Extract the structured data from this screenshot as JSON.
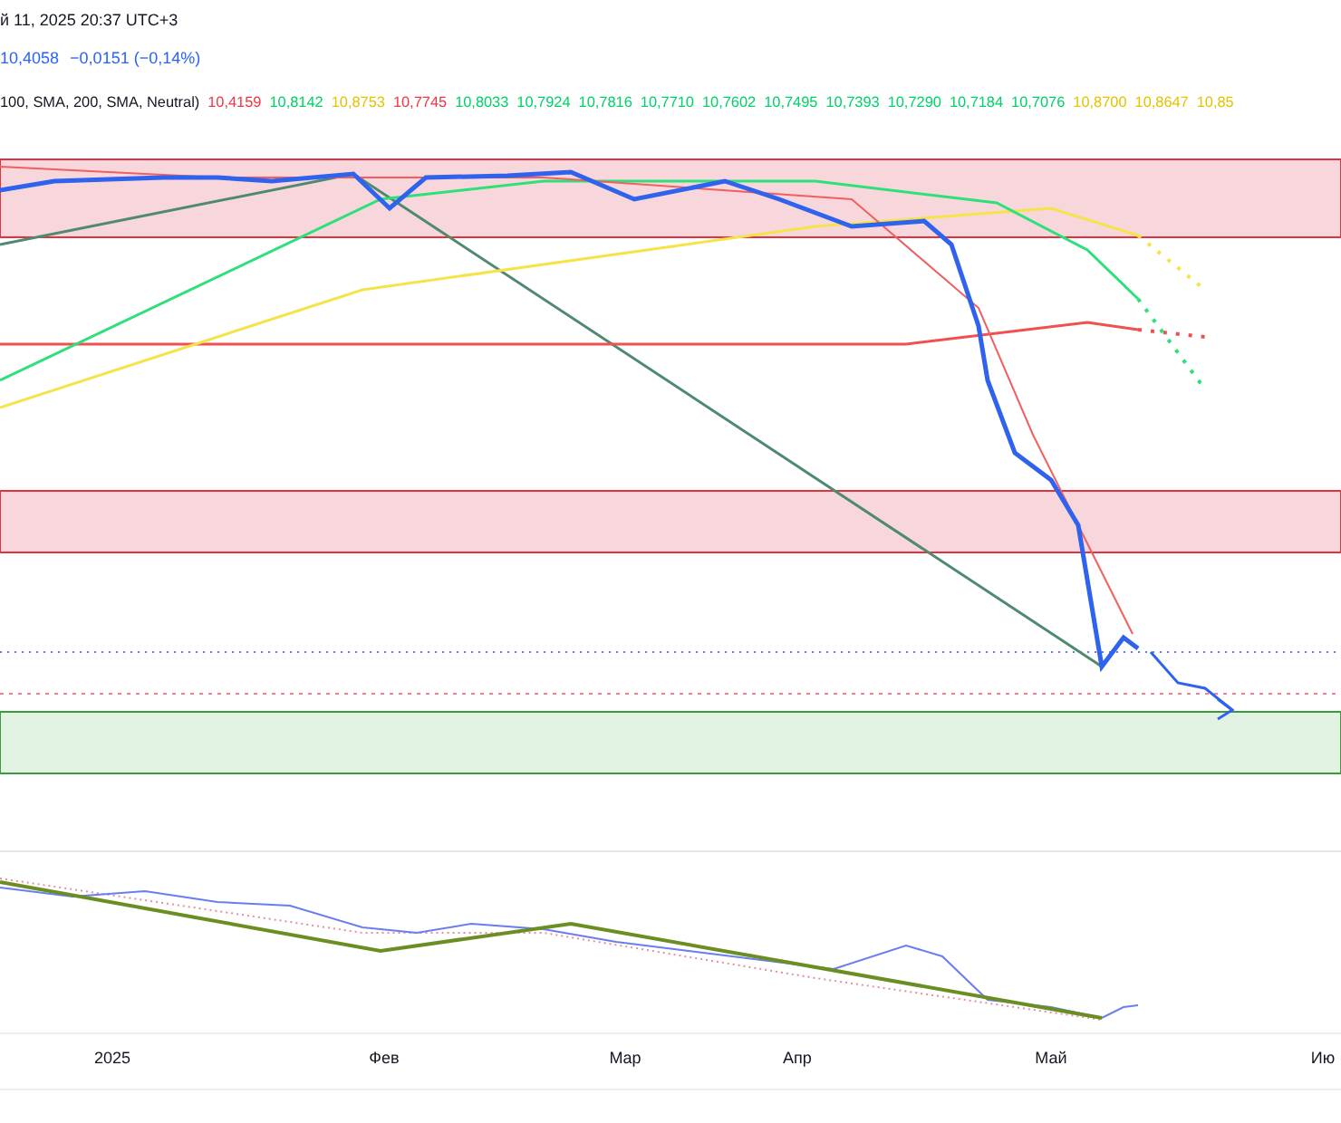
{
  "header": {
    "datetime": "й 11, 2025 20:37 UTC+3"
  },
  "price": {
    "value": "10,4058",
    "change": "−0,0151 (−0,14%)"
  },
  "indicator": {
    "label": "100, SMA, 200, SMA, Neutral)",
    "values": [
      {
        "text": "10,4159",
        "color": "#f23645"
      },
      {
        "text": "10,8142",
        "color": "#00d26a"
      },
      {
        "text": "10,8753",
        "color": "#e6c200"
      },
      {
        "text": "10,7745",
        "color": "#f23645"
      },
      {
        "text": "10,8033",
        "color": "#00d26a"
      },
      {
        "text": "10,7924",
        "color": "#00d26a"
      },
      {
        "text": "10,7816",
        "color": "#00d26a"
      },
      {
        "text": "10,7710",
        "color": "#00d26a"
      },
      {
        "text": "10,7602",
        "color": "#00d26a"
      },
      {
        "text": "10,7495",
        "color": "#00d26a"
      },
      {
        "text": "10,7393",
        "color": "#00d26a"
      },
      {
        "text": "10,7290",
        "color": "#00d26a"
      },
      {
        "text": "10,7184",
        "color": "#00d26a"
      },
      {
        "text": "10,7076",
        "color": "#00d26a"
      },
      {
        "text": "10,8700",
        "color": "#e6c200"
      },
      {
        "text": "10,8647",
        "color": "#e6c200"
      },
      {
        "text": "10,85",
        "color": "#e6c200"
      }
    ]
  },
  "x_axis": {
    "labels": [
      "2025",
      "Фев",
      "Мар",
      "Апр",
      "Май",
      "Ию"
    ]
  }
}
